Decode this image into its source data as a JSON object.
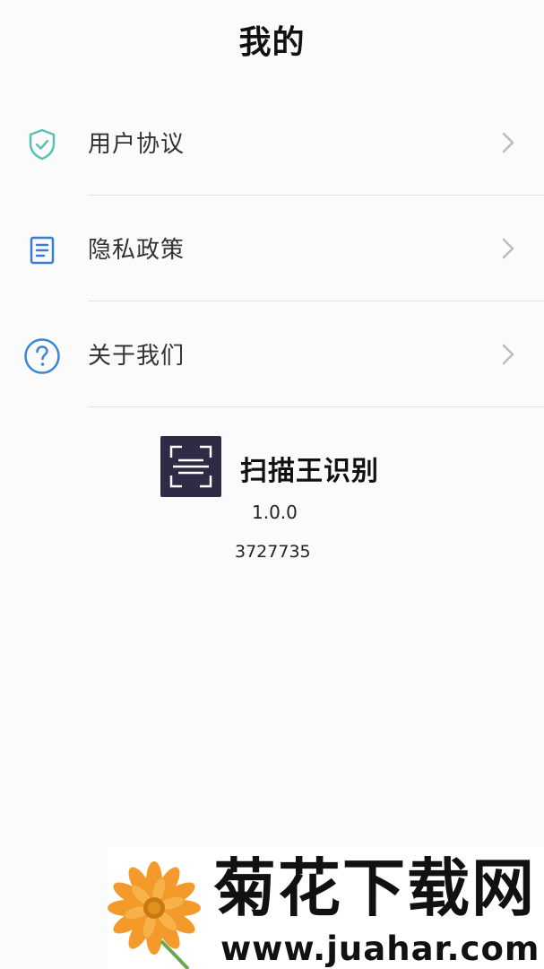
{
  "header": {
    "title": "我的"
  },
  "menu": {
    "items": [
      {
        "label": "用户协议",
        "icon": "shield-check-icon"
      },
      {
        "label": "隐私政策",
        "icon": "document-icon"
      },
      {
        "label": "关于我们",
        "icon": "question-circle-icon"
      }
    ]
  },
  "app": {
    "name": "扫描王识别",
    "version": "1.0.0",
    "code": "3727735",
    "logo_color": "#2f2b45"
  },
  "watermark": {
    "title": "菊花下载网",
    "url": "www.juahar.com"
  },
  "colors": {
    "shield": "#5cc0b4",
    "document": "#3a7bd5",
    "question": "#3a86d8",
    "chevron": "#bdbdbd"
  }
}
